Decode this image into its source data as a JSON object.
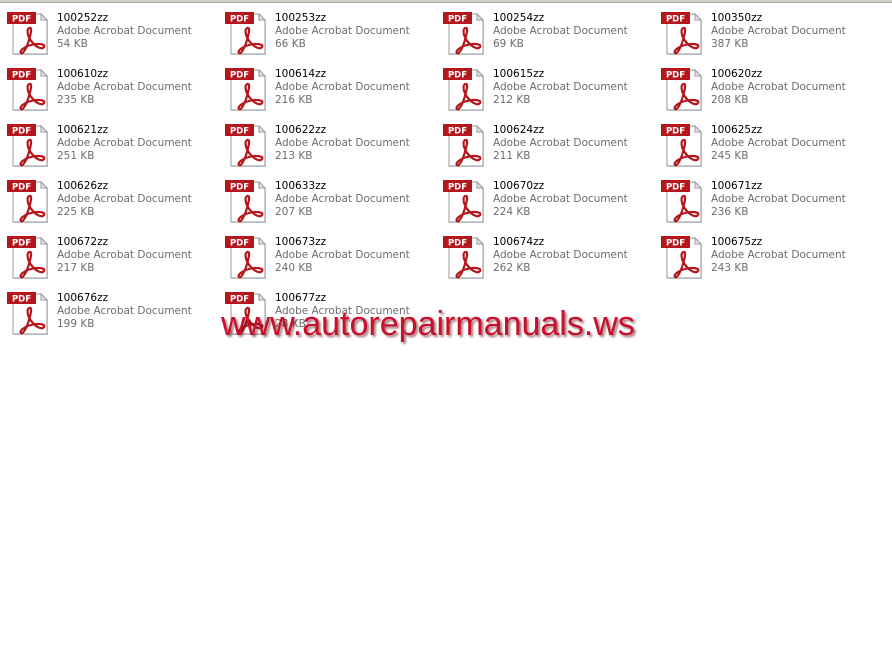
{
  "files": [
    {
      "name": "100252zz",
      "type": "Adobe Acrobat Document",
      "size": "54 KB",
      "icon": "pdf-icon"
    },
    {
      "name": "100253zz",
      "type": "Adobe Acrobat Document",
      "size": "66 KB",
      "icon": "pdf-icon"
    },
    {
      "name": "100254zz",
      "type": "Adobe Acrobat Document",
      "size": "69 KB",
      "icon": "pdf-icon"
    },
    {
      "name": "100350zz",
      "type": "Adobe Acrobat Document",
      "size": "387 KB",
      "icon": "pdf-icon"
    },
    {
      "name": "100610zz",
      "type": "Adobe Acrobat Document",
      "size": "235 KB",
      "icon": "pdf-icon"
    },
    {
      "name": "100614zz",
      "type": "Adobe Acrobat Document",
      "size": "216 KB",
      "icon": "pdf-icon"
    },
    {
      "name": "100615zz",
      "type": "Adobe Acrobat Document",
      "size": "212 KB",
      "icon": "pdf-icon"
    },
    {
      "name": "100620zz",
      "type": "Adobe Acrobat Document",
      "size": "208 KB",
      "icon": "pdf-icon"
    },
    {
      "name": "100621zz",
      "type": "Adobe Acrobat Document",
      "size": "251 KB",
      "icon": "pdf-icon"
    },
    {
      "name": "100622zz",
      "type": "Adobe Acrobat Document",
      "size": "213 KB",
      "icon": "pdf-icon"
    },
    {
      "name": "100624zz",
      "type": "Adobe Acrobat Document",
      "size": "211 KB",
      "icon": "pdf-icon"
    },
    {
      "name": "100625zz",
      "type": "Adobe Acrobat Document",
      "size": "245 KB",
      "icon": "pdf-icon"
    },
    {
      "name": "100626zz",
      "type": "Adobe Acrobat Document",
      "size": "225 KB",
      "icon": "pdf-icon"
    },
    {
      "name": "100633zz",
      "type": "Adobe Acrobat Document",
      "size": "207 KB",
      "icon": "pdf-icon"
    },
    {
      "name": "100670zz",
      "type": "Adobe Acrobat Document",
      "size": "224 KB",
      "icon": "pdf-icon"
    },
    {
      "name": "100671zz",
      "type": "Adobe Acrobat Document",
      "size": "236 KB",
      "icon": "pdf-icon"
    },
    {
      "name": "100672zz",
      "type": "Adobe Acrobat Document",
      "size": "217 KB",
      "icon": "pdf-icon"
    },
    {
      "name": "100673zz",
      "type": "Adobe Acrobat Document",
      "size": "240 KB",
      "icon": "pdf-icon"
    },
    {
      "name": "100674zz",
      "type": "Adobe Acrobat Document",
      "size": "262 KB",
      "icon": "pdf-icon"
    },
    {
      "name": "100675zz",
      "type": "Adobe Acrobat Document",
      "size": "243 KB",
      "icon": "pdf-icon"
    },
    {
      "name": "100676zz",
      "type": "Adobe Acrobat Document",
      "size": "199 KB",
      "icon": "pdf-icon"
    },
    {
      "name": "100677zz",
      "type": "Adobe Acrobat Document",
      "size": "28 KB",
      "icon": "pdf-icon"
    }
  ],
  "watermark": {
    "text": "www.autorepairmanuals.ws",
    "color": "#c8102e"
  },
  "colors": {
    "pdf_badge": "#b5161c",
    "acrobat_logo": "#b5161c",
    "secondary_text": "#6d6d6d"
  }
}
